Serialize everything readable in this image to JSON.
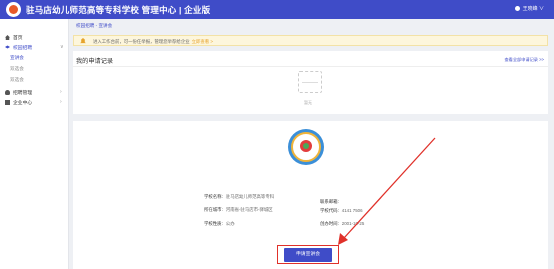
{
  "header": {
    "title": "驻马店幼儿师范高等专科学校 管理中心 | 企业版",
    "user": "王晓峰 ∨"
  },
  "sidebar": {
    "items": [
      {
        "label": "首页",
        "icon": "home-icon"
      },
      {
        "label": "校园招聘",
        "icon": "graduation-cap-icon",
        "arrow": "∨"
      },
      {
        "label": "招聘管理",
        "icon": "person-icon",
        "arrow": "›"
      },
      {
        "label": "企业中心",
        "icon": "building-icon",
        "arrow": "›"
      }
    ],
    "sub_items": [
      "宣讲会",
      "双选会",
      "双选会"
    ]
  },
  "breadcrumb": "校园招聘 - 宣讲会",
  "notice": {
    "text": "进入工作台前，可一份任举报，管理您举荐给企业",
    "link": "立即查看 >"
  },
  "records": {
    "title": "我的申请记录",
    "view_all": "查看全部申请记录 >>",
    "empty_text": "暂无"
  },
  "school": {
    "name_label": "学校名称:",
    "name_value": "驻马店幼儿师范高等专科",
    "city_label": "所在城市:",
    "city_value": "河南省-驻马店市-驿城区",
    "nature_label": "学校性质:",
    "nature_value": "公办",
    "contact_label": "联系邮箱:",
    "contact_value": "",
    "code_label": "学校代码:",
    "code_value": "4141 7506",
    "time_label": "创办时间:",
    "time_value": "2001-10-25"
  },
  "apply_button": "申请宣讲会",
  "colors": {
    "brand": "#3f4cc8",
    "highlight": "#e0312a"
  }
}
